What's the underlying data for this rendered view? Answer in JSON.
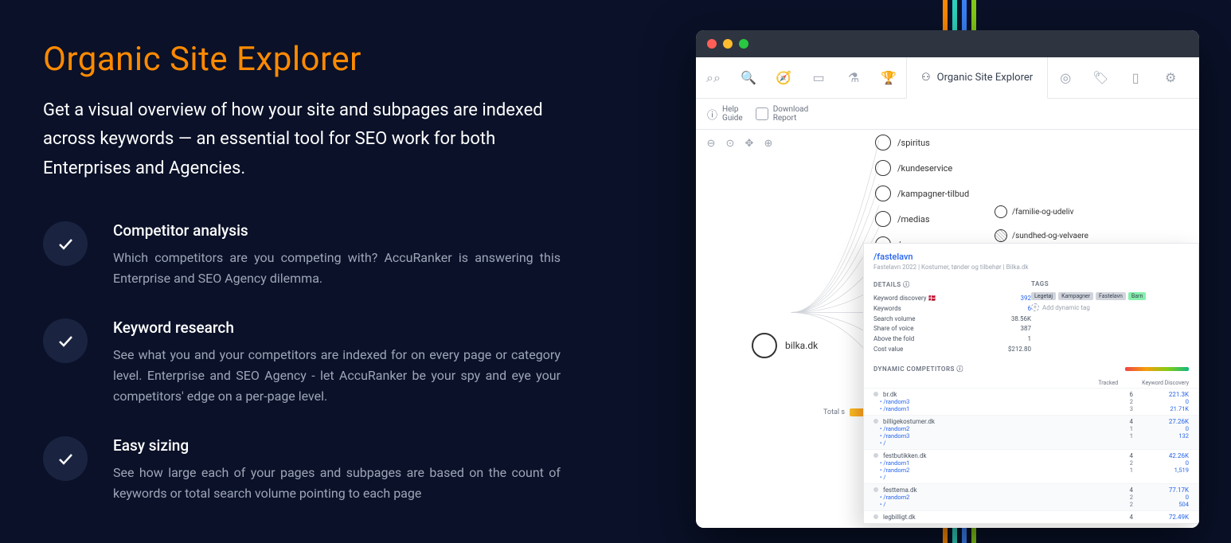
{
  "page": {
    "title": "Organic Site Explorer",
    "subtitle": "Get a visual overview of how your site and subpages are indexed across keywords — an essential tool for SEO work for both Enterprises and Agencies.",
    "features": [
      {
        "title": "Competitor analysis",
        "desc": "Which competitors are you competing with? AccuRanker is answering this Enterprise and SEO Agency dilemma."
      },
      {
        "title": "Keyword research",
        "desc": "See what you and your competitors are indexed for on every page or category level. Enterprise and SEO Agency - let AccuRanker be your spy and eye your competitors' edge on a per-page level."
      },
      {
        "title": "Easy sizing",
        "desc": "See how large each of your pages and subpages are based on the count of keywords or total search volume pointing to each page"
      }
    ]
  },
  "app": {
    "tab_label": "Organic Site Explorer",
    "toolbar": {
      "help_label": "Help",
      "guide_label": "Guide",
      "download_label": "Download",
      "report_label": "Report"
    },
    "root_node": "bilka.dk",
    "total_label": "Total s",
    "children": [
      {
        "label": "/spiritus"
      },
      {
        "label": "/kundeservice"
      },
      {
        "label": "/kampagner-tilbud"
      },
      {
        "label": "/medias"
      },
      {
        "label": "/c"
      }
    ],
    "sub_children": [
      {
        "label": "/familie-og-udeliv"
      },
      {
        "label": "/sundhed-og-velvaere",
        "hatch": true
      }
    ],
    "panel": {
      "crumb": "/fastelavn",
      "sub": "Fastelavn 2022  |  Kostumer, tønder og tilbehør  |  Bilka.dk",
      "details_header": "DETAILS",
      "tags_header": "TAGS",
      "details": [
        {
          "k": "Keyword discovery 🇩🇰",
          "v": "392",
          "blue": true
        },
        {
          "k": "Keywords",
          "v": "6",
          "blue": true
        },
        {
          "k": "Search volume",
          "v": "38.56K"
        },
        {
          "k": "Share of voice",
          "v": "387"
        },
        {
          "k": "Above the fold",
          "v": "1"
        },
        {
          "k": "Cost value",
          "v": "$212.80"
        }
      ],
      "tags": [
        "Legetøj",
        "Kampagner",
        "Fastelavn",
        "Barn"
      ],
      "add_tag_label": "Add dynamic tag",
      "dyn_header": "DYNAMIC COMPETITORS",
      "col_tracked": "Tracked",
      "col_disc": "Keyword Discovery",
      "competitors": [
        {
          "name": "br.dk",
          "tracked": "6",
          "disc": "221.3K",
          "subs": [
            {
              "name": "• /random3",
              "t": "2",
              "d": "0"
            },
            {
              "name": "• /random1",
              "t": "3",
              "d": "21.71K"
            }
          ]
        },
        {
          "name": "billigekostumer.dk",
          "tracked": "4",
          "disc": "27.26K",
          "alt": true,
          "subs": [
            {
              "name": "• /random2",
              "t": "1",
              "d": "0"
            },
            {
              "name": "• /random3",
              "t": "1",
              "d": "132"
            },
            {
              "name": "• /",
              "t": "",
              "d": ""
            }
          ]
        },
        {
          "name": "festbutikken.dk",
          "tracked": "4",
          "disc": "42.26K",
          "subs": [
            {
              "name": "• /random1",
              "t": "2",
              "d": "0"
            },
            {
              "name": "• /random2",
              "t": "1",
              "d": "1,519"
            },
            {
              "name": "• /",
              "t": "",
              "d": ""
            }
          ]
        },
        {
          "name": "festtema.dk",
          "tracked": "4",
          "disc": "77.17K",
          "alt": true,
          "subs": [
            {
              "name": "• /random2",
              "t": "2",
              "d": "0"
            },
            {
              "name": "• /",
              "t": "2",
              "d": "504"
            }
          ]
        },
        {
          "name": "legbilligt.dk",
          "tracked": "4",
          "disc": "72.49K",
          "subs": []
        }
      ]
    }
  }
}
